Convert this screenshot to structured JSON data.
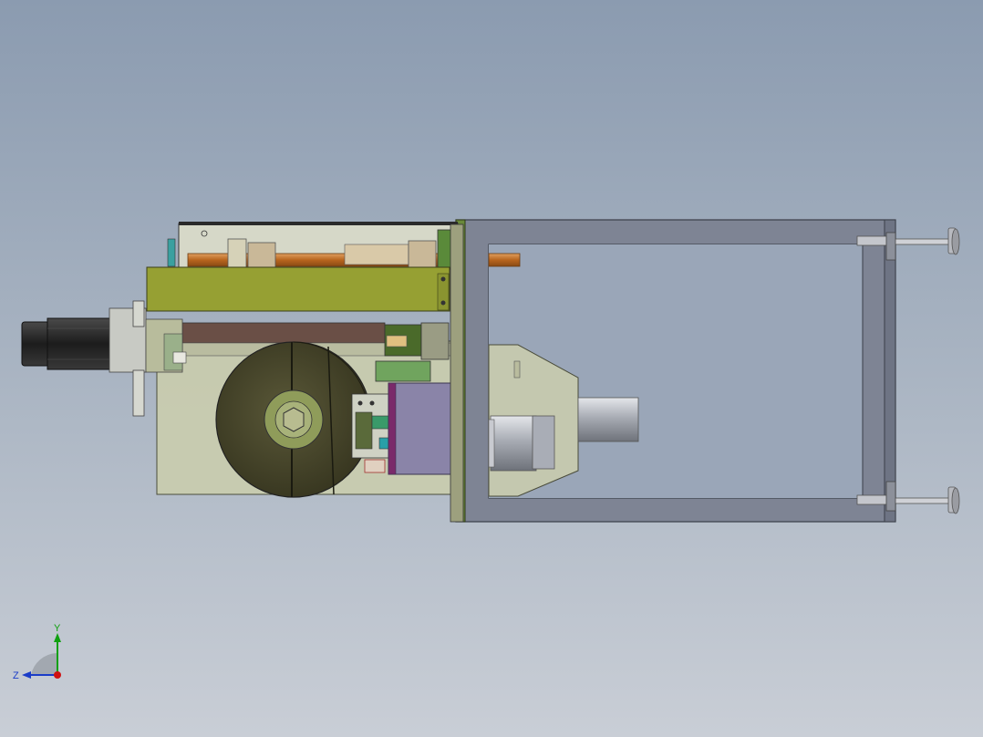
{
  "triad": {
    "y_label": "Y",
    "z_label": "Z",
    "colors": {
      "y": "#10a010",
      "z": "#1a3cc8",
      "x": "#d01010"
    }
  },
  "model": {
    "colors": {
      "frame": "#7e8494",
      "frame_edge": "#3a3e48",
      "olive_plate": "#96a033",
      "housing": "#c9ccae",
      "disc": "#45432b",
      "motor": "#1e1e1e",
      "pipe": "#c8782a",
      "purple_block": "#8a84a8",
      "cylinder": "#b0b4bc",
      "green_plate": "#6a8a3a"
    }
  }
}
